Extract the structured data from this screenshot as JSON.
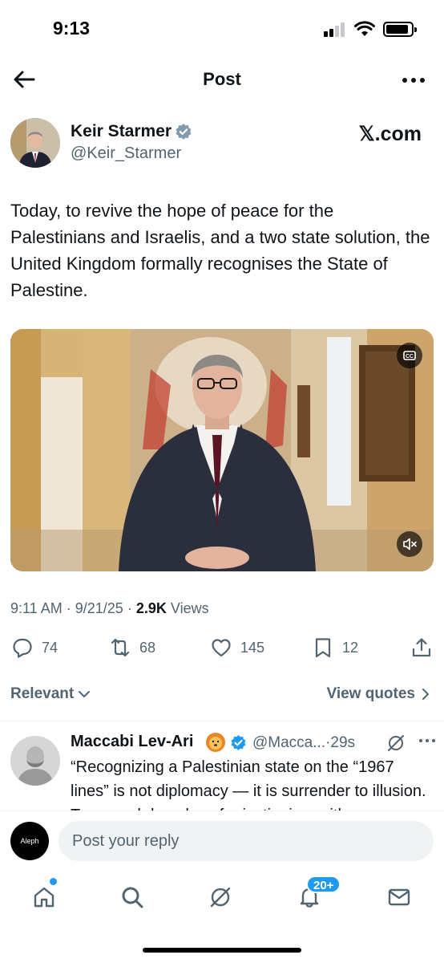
{
  "status_bar": {
    "time": "9:13"
  },
  "nav": {
    "title": "Post"
  },
  "author": {
    "name": "Keir Starmer",
    "handle": "@Keir_Starmer",
    "source": "𝕏.com"
  },
  "post": {
    "text": "Today, to revive the hope of peace for the Palestinians and Israelis, and a two state solution, the United Kingdom formally recognises the State of Palestine.",
    "time": "9:11 AM",
    "date": "9/21/25",
    "views_count": "2.9K",
    "views_label": "Views",
    "separator": "·"
  },
  "actions": {
    "replies": "74",
    "reposts": "68",
    "likes": "145",
    "bookmarks": "12"
  },
  "filters": {
    "sort_label": "Relevant",
    "view_quotes": "View quotes"
  },
  "reply": {
    "name": "Maccabi Lev-Ari",
    "handle": "@Macca...",
    "separator": "·",
    "age": "29s",
    "text": "“Recognizing a Palestinian state on the “1967 lines” is not diplomacy — it is surrender to illusion. To reward decades of rejectionism with"
  },
  "composer": {
    "placeholder": "Post your reply",
    "my_avatar_text": "Aleph"
  },
  "tabbar": {
    "notification_badge": "20+"
  },
  "colors": {
    "accent": "#1d9bf0",
    "secondary_text": "#536471",
    "primary_text": "#0f1419"
  },
  "icons": {
    "back": "arrow-left-icon",
    "more": "more-horizontal-icon",
    "verified": "verified-badge-icon",
    "cc": "closed-captions-icon",
    "mute": "speaker-muted-icon",
    "reply": "reply-bubble-icon",
    "repost": "repost-icon",
    "like": "heart-icon",
    "bookmark": "bookmark-icon",
    "share": "share-icon",
    "grok": "grok-icon",
    "home": "home-icon",
    "search": "search-icon",
    "notifications": "bell-icon",
    "messages": "mail-icon"
  }
}
